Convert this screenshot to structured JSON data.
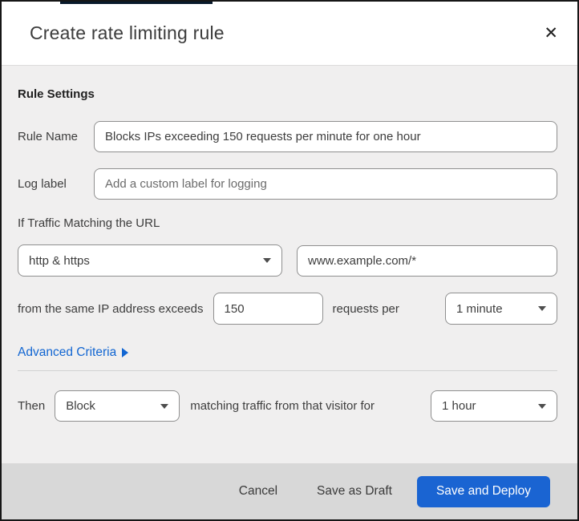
{
  "dialog": {
    "title": "Create rate limiting rule",
    "close_icon": "✕"
  },
  "colors": {
    "accent_blue": "#1a64d2",
    "link_blue": "#1266d2",
    "top_strip": "#08192b"
  },
  "rule_settings": {
    "heading": "Rule Settings",
    "rule_name": {
      "label": "Rule Name",
      "value": "Blocks IPs exceeding 150 requests per minute for one hour"
    },
    "log_label": {
      "label": "Log label",
      "placeholder": "Add a custom label for logging"
    },
    "traffic_match": {
      "intro": "If Traffic Matching the URL",
      "scheme_selected": "http & https",
      "url_value": "www.example.com/*",
      "threshold_prefix": "from the same IP address exceeds",
      "threshold_value": "150",
      "threshold_suffix": "requests per",
      "period_selected": "1 minute",
      "advanced_link": "Advanced Criteria"
    },
    "action": {
      "prefix": "Then",
      "action_selected": "Block",
      "middle": "matching traffic from that visitor for",
      "duration_selected": "1 hour"
    }
  },
  "footer": {
    "cancel": "Cancel",
    "save_draft": "Save as Draft",
    "save_deploy": "Save and Deploy"
  }
}
